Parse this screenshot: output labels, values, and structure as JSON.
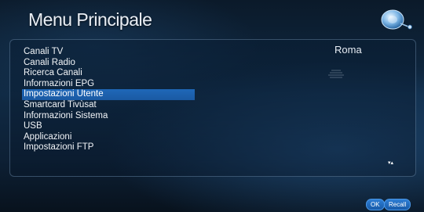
{
  "header": {
    "title": "Menu Principale"
  },
  "menu": {
    "items": [
      {
        "label": "Canali TV"
      },
      {
        "label": "Canali Radio"
      },
      {
        "label": "Ricerca Canali"
      },
      {
        "label": "Informazioni EPG"
      },
      {
        "label": "Impostazioni Utente"
      },
      {
        "label": "Smartcard Tivùsat"
      },
      {
        "label": "Informazioni Sistema"
      },
      {
        "label": "USB"
      },
      {
        "label": "Applicazioni"
      },
      {
        "label": "Impostazioni FTP"
      }
    ],
    "selected_index": 4
  },
  "info": {
    "city": "Roma"
  },
  "footer": {
    "scroll_indicator": "▾▴",
    "ok_label": "OK",
    "recall_label": "Recall"
  },
  "colors": {
    "selection": "#1f68b8",
    "button": "#2e7ed4",
    "text": "#f2f5f8"
  },
  "icons": {
    "logo": "tivusat-dish-logo-icon",
    "signal": "signal-lines-icon"
  }
}
